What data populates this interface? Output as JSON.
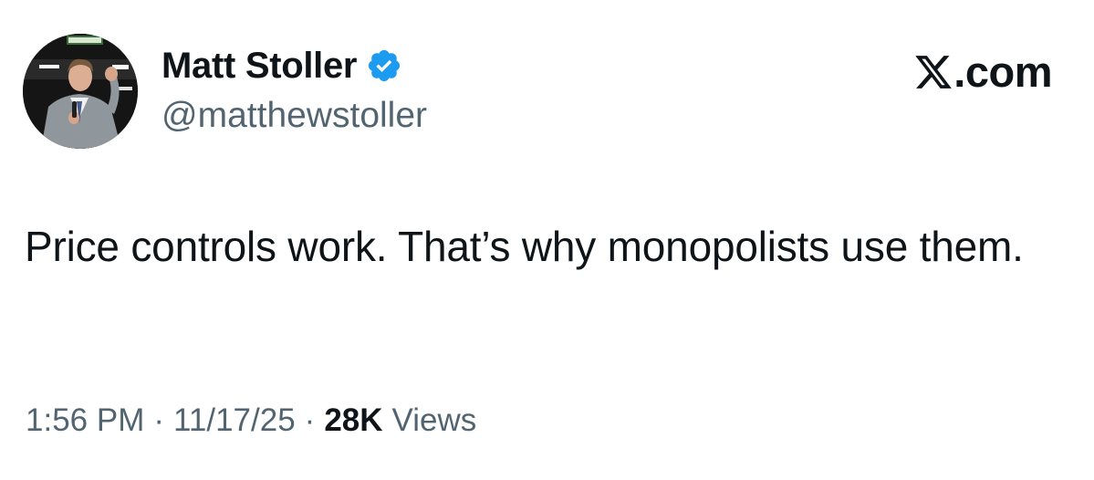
{
  "author": {
    "display_name": "Matt Stoller",
    "handle": "@matthewstoller",
    "verified": true,
    "verified_color": "#1d9bf0"
  },
  "brand": {
    "domain_label": ".com",
    "logo_icon": "x-logo-icon"
  },
  "tweet": {
    "text": "Price controls work. That’s why monopolists use them."
  },
  "meta": {
    "time": "1:56 PM",
    "separator": "·",
    "date": "11/17/25",
    "views_count": "28K",
    "views_label": "Views"
  },
  "colors": {
    "text_primary": "#0f1419",
    "text_secondary": "#536471",
    "background": "#ffffff"
  }
}
